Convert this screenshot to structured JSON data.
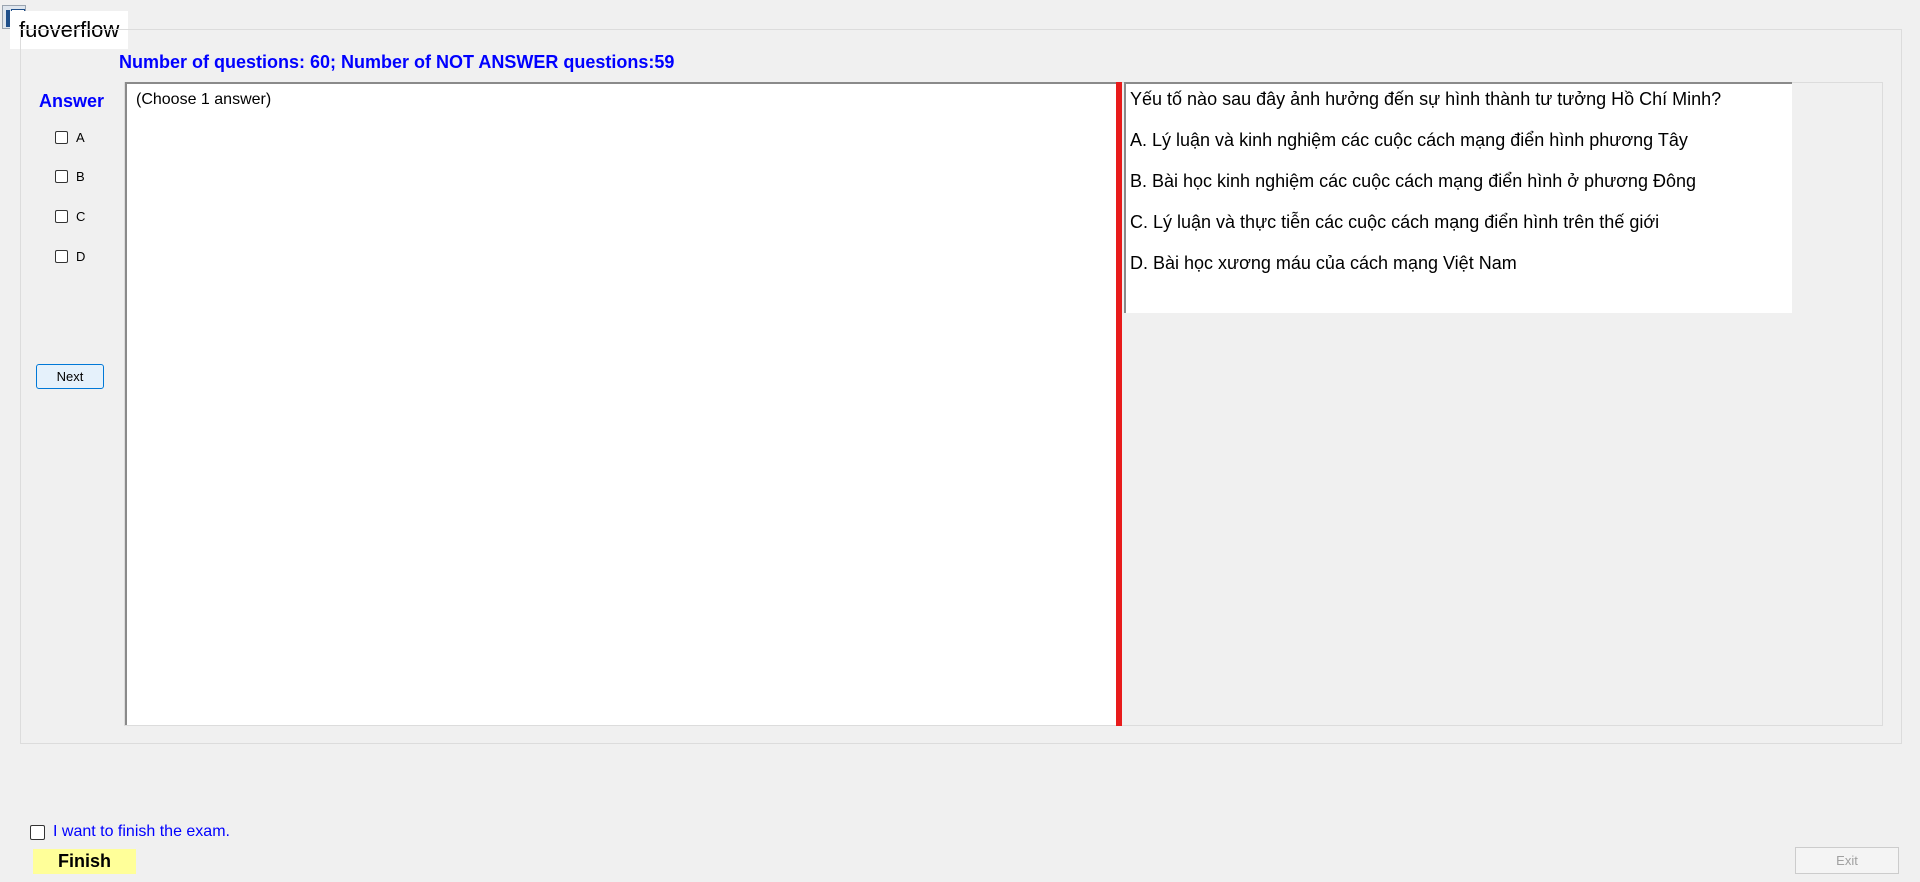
{
  "app": {
    "title": "fuoverflow",
    "icon": "app-icon"
  },
  "summary": {
    "text": "Number of questions: 60; Number of NOT ANSWER questions:59"
  },
  "answer": {
    "label": "Answer",
    "options": [
      {
        "label": "A",
        "checked": false
      },
      {
        "label": "B",
        "checked": false
      },
      {
        "label": "C",
        "checked": false
      },
      {
        "label": "D",
        "checked": false
      }
    ],
    "next_label": "Next"
  },
  "answer_panel": {
    "instruction": "(Choose 1 answer)"
  },
  "question": {
    "lines": [
      "Yếu tố nào  sau đây ảnh hưởng đến sự hình thành tư tưởng Hồ Chí Minh?",
      "A.  Lý luận và kinh nghiệm các cuộc cách mạng điển hình phương Tây",
      "B.  Bài học  kinh nghiệm các cuộc cách mạng điển hình ở phương Đông",
      "C.  Lý luận và thực tiễn các cuộc cách mạng điển hình trên thế giới",
      "D.  Bài học xương máu của cách mạng Việt Nam"
    ]
  },
  "footer": {
    "finish_check_label": "I want to finish the exam.",
    "finish_checked": false,
    "finish_label": "Finish",
    "exit_label": "Exit"
  },
  "colors": {
    "accent": "#0000ff",
    "splitter": "#e81b1b",
    "finish_bg": "#ffff99"
  }
}
